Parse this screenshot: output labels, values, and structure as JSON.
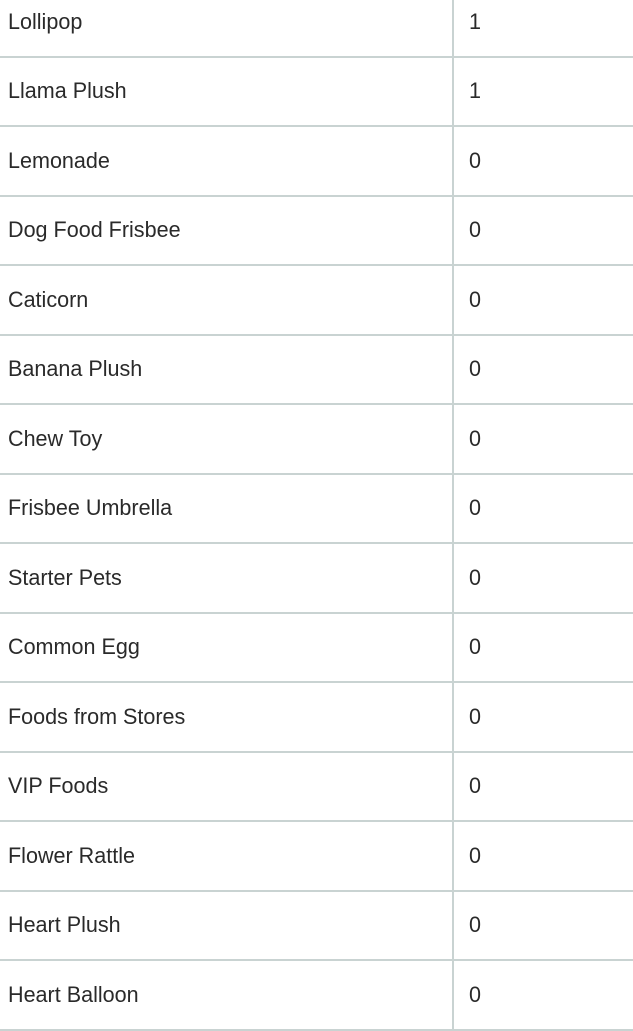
{
  "colors": {
    "border": "#c9d3d2",
    "text": "#2a2a2a",
    "background": "#ffffff"
  },
  "rows": [
    {
      "name": "Lollipop",
      "qty": "1"
    },
    {
      "name": "Llama Plush",
      "qty": "1"
    },
    {
      "name": "Lemonade",
      "qty": "0"
    },
    {
      "name": "Dog Food Frisbee",
      "qty": "0"
    },
    {
      "name": "Caticorn",
      "qty": "0"
    },
    {
      "name": "Banana Plush",
      "qty": "0"
    },
    {
      "name": "Chew Toy",
      "qty": "0"
    },
    {
      "name": "Frisbee Umbrella",
      "qty": "0"
    },
    {
      "name": "Starter Pets",
      "qty": "0"
    },
    {
      "name": "Common Egg",
      "qty": "0"
    },
    {
      "name": "Foods from Stores",
      "qty": "0"
    },
    {
      "name": "VIP Foods",
      "qty": "0"
    },
    {
      "name": "Flower Rattle",
      "qty": "0"
    },
    {
      "name": "Heart Plush",
      "qty": "0"
    },
    {
      "name": "Heart Balloon",
      "qty": "0"
    }
  ]
}
